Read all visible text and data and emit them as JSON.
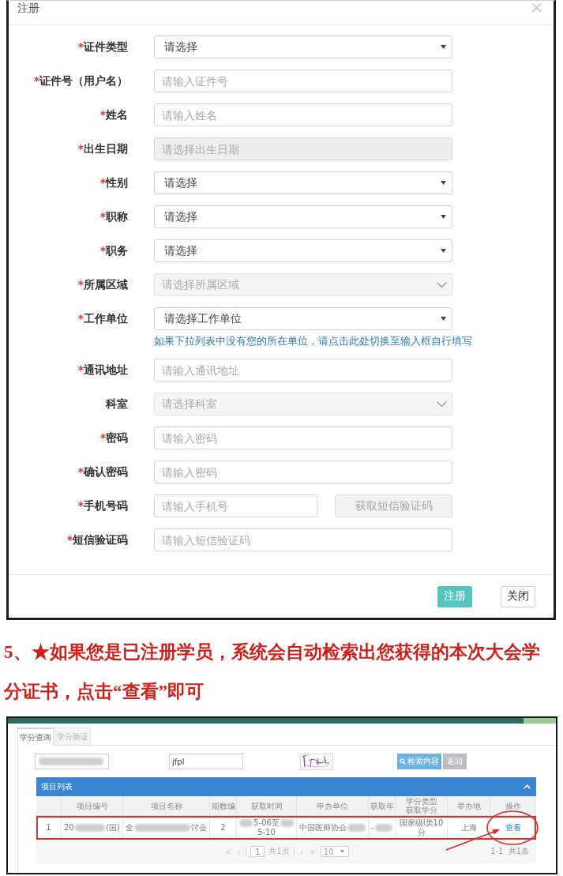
{
  "dialog": {
    "title": "注册",
    "close": "×",
    "fields": [
      {
        "kind": "select",
        "required_mark": "*",
        "label": "证件类型",
        "value": "请选择"
      },
      {
        "kind": "input",
        "required_mark": "*",
        "label": "证件号（用户名）",
        "placeholder": "请输入证件号"
      },
      {
        "kind": "input",
        "required_mark": "*",
        "label": "姓名",
        "placeholder": "请输入姓名"
      },
      {
        "kind": "date",
        "required_mark": "*",
        "label": "出生日期",
        "placeholder": "请选择出生日期"
      },
      {
        "kind": "select",
        "required_mark": "*",
        "label": "性别",
        "value": "请选择"
      },
      {
        "kind": "select",
        "required_mark": "*",
        "label": "职称",
        "value": "请选择"
      },
      {
        "kind": "select",
        "required_mark": "*",
        "label": "职务",
        "value": "请选择"
      },
      {
        "kind": "picker",
        "required_mark": "*",
        "label": "所属区域",
        "placeholder": "请选择所属区域"
      },
      {
        "kind": "select",
        "required_mark": "*",
        "label": "工作单位",
        "value": "请选择工作单位",
        "hint": "如果下拉列表中没有您的所在单位，请点击此处切换至输入框自行填写"
      },
      {
        "kind": "input",
        "required_mark": "*",
        "label": "通讯地址",
        "placeholder": "请输入通讯地址"
      },
      {
        "kind": "picker",
        "label": "科室",
        "placeholder": "请选择科室"
      },
      {
        "kind": "input",
        "required_mark": "*",
        "label": "密码",
        "placeholder": "请输入密码"
      },
      {
        "kind": "input",
        "required_mark": "*",
        "label": "确认密码",
        "placeholder": "请输入密码"
      },
      {
        "kind": "sms",
        "required_mark": "*",
        "label": "手机号码",
        "placeholder": "请输入手机号",
        "button": "获取短信验证码"
      },
      {
        "kind": "input",
        "required_mark": "*",
        "label": "短信验证码",
        "placeholder": "请输入短信验证码"
      }
    ],
    "buttons": [
      {
        "kind": "primary",
        "label": "注册"
      },
      {
        "kind": "default",
        "label": "关闭"
      }
    ]
  },
  "note": "5、★如果您是已注册学员，系统会自动检索出您获得的本次大会学分证书，点击“查看”即可",
  "credit_query": {
    "tabs": [
      {
        "label": "学分查询",
        "selected": true
      },
      {
        "label": "学分验证",
        "selected": false
      }
    ],
    "id_field": {
      "blurred": true
    },
    "code_field": {
      "value": "jfpl"
    },
    "buttons": [
      {
        "kind": "search",
        "label": "检索内容"
      },
      {
        "kind": "back",
        "label": "返回"
      }
    ],
    "panel": {
      "title": "项目列表",
      "expanded": true
    },
    "table": {
      "columns": [
        "项目编号",
        "项目名称",
        "期数编",
        "获取时间",
        "申办单位",
        "获取年",
        "学分类型获取学分",
        "举办地",
        "操作"
      ],
      "rows": [
        {
          "highlighted": true,
          "index": "1",
          "cells": [
            [
              [
                {
                  "kind": "text",
                  "text": "20"
                },
                {
                  "kind": "blur"
                },
                {
                  "kind": "text",
                  "text": "(国)"
                }
              ]
            ],
            [
              [
                {
                  "kind": "text",
                  "text": "全"
                },
                {
                  "kind": "blur"
                },
                {
                  "kind": "text",
                  "text": "讨会"
                }
              ]
            ],
            [
              [
                {
                  "kind": "text",
                  "text": "2"
                }
              ]
            ],
            [
              [
                {
                  "kind": "blur"
                },
                {
                  "kind": "text",
                  "text": "5-06至"
                },
                {
                  "kind": "blur"
                }
              ],
              [
                {
                  "kind": "text",
                  "text": "5-10"
                }
              ]
            ],
            [
              [
                {
                  "kind": "text",
                  "text": "中国医师协会"
                },
                {
                  "kind": "blur"
                }
              ]
            ],
            [
              [
                {
                  "kind": "text",
                  "text": "-"
                },
                {
                  "kind": "blur"
                }
              ]
            ],
            [
              [
                {
                  "kind": "text",
                  "text": "国家级Ⅰ类10分"
                }
              ]
            ],
            [
              [
                {
                  "kind": "text",
                  "text": "上海"
                }
              ]
            ],
            [
              [
                {
                  "kind": "link",
                  "text": "查看",
                  "circled": true,
                  "arrow": true
                }
              ]
            ]
          ]
        }
      ]
    },
    "pagination": {
      "first": "«",
      "prev": "‹",
      "page": "1",
      "total": "共1页",
      "next": "›",
      "last": "»",
      "page_size": "10",
      "summary": "1-1  共1条"
    }
  }
}
